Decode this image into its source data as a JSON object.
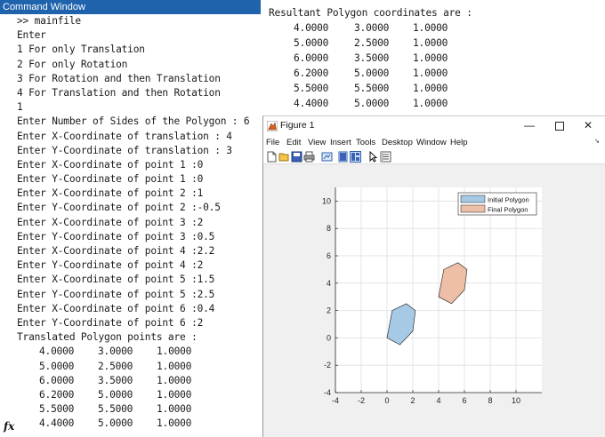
{
  "command_window": {
    "title": "Command Window",
    "lines": [
      ">> mainfile",
      "Enter",
      "1 For only Translation",
      "2 For only Rotation",
      "3 For Rotation and then Translation",
      "4 For Translation and then Rotation",
      "1",
      "Enter Number of Sides of the Polygon : 6",
      "Enter X-Coordinate of translation : 4",
      "Enter Y-Coordinate of translation : 3",
      "Enter X-Coordinate of point 1 :0",
      "Enter Y-Coordinate of point 1 :0",
      "Enter X-Coordinate of point 2 :1",
      "Enter Y-Coordinate of point 2 :-0.5",
      "Enter X-Coordinate of point 3 :2",
      "Enter Y-Coordinate of point 3 :0.5",
      "Enter X-Coordinate of point 4 :2.2",
      "Enter Y-Coordinate of point 4 :2",
      "Enter X-Coordinate of point 5 :1.5",
      "Enter Y-Coordinate of point 5 :2.5",
      "Enter X-Coordinate of point 6 :0.4",
      "Enter Y-Coordinate of point 6 :2",
      "Translated Polygon points are :"
    ],
    "matrix": [
      [
        "4.0000",
        "3.0000",
        "1.0000"
      ],
      [
        "5.0000",
        "2.5000",
        "1.0000"
      ],
      [
        "6.0000",
        "3.5000",
        "1.0000"
      ],
      [
        "6.2000",
        "5.0000",
        "1.0000"
      ],
      [
        "5.5000",
        "5.5000",
        "1.0000"
      ],
      [
        "4.4000",
        "5.0000",
        "1.0000"
      ]
    ],
    "prompt_icon": "fx-icon"
  },
  "result": {
    "heading": "Resultant Polygon coordinates are :",
    "matrix": [
      [
        "4.0000",
        "3.0000",
        "1.0000"
      ],
      [
        "5.0000",
        "2.5000",
        "1.0000"
      ],
      [
        "6.0000",
        "3.5000",
        "1.0000"
      ],
      [
        "6.2000",
        "5.0000",
        "1.0000"
      ],
      [
        "5.5000",
        "5.5000",
        "1.0000"
      ],
      [
        "4.4000",
        "5.0000",
        "1.0000"
      ]
    ]
  },
  "figure": {
    "title": "Figure 1",
    "window_buttons": [
      "minimize-icon",
      "maximize-icon",
      "close-icon"
    ],
    "menu": [
      "File",
      "Edit",
      "View",
      "Insert",
      "Tools",
      "Desktop",
      "Window",
      "Help"
    ],
    "toolbar_icons": [
      "new-figure-icon",
      "open-icon",
      "save-icon",
      "print-icon",
      "link-plot-icon",
      "hide-plot-tools-icon",
      "show-plot-tools-icon",
      "pointer-icon",
      "property-inspector-icon"
    ]
  },
  "chart_data": {
    "type": "area",
    "xlim": [
      -4,
      12
    ],
    "ylim": [
      -4,
      11
    ],
    "xticks": [
      -4,
      -2,
      0,
      2,
      4,
      6,
      8,
      10
    ],
    "yticks": [
      -4,
      -2,
      0,
      2,
      4,
      6,
      8,
      10
    ],
    "grid": true,
    "legend": "top-right",
    "series": [
      {
        "name": "Initial Polygon",
        "color": "#a6c9e6",
        "edge": "#1a1a1a",
        "x": [
          0,
          1,
          2,
          2.2,
          1.5,
          0.4
        ],
        "y": [
          0,
          -0.5,
          0.5,
          2,
          2.5,
          2
        ]
      },
      {
        "name": "Final Polygon",
        "color": "#eebfa6",
        "edge": "#1a1a1a",
        "x": [
          4,
          5,
          6,
          6.2,
          5.5,
          4.4
        ],
        "y": [
          3,
          2.5,
          3.5,
          5,
          5.5,
          5
        ]
      }
    ]
  }
}
